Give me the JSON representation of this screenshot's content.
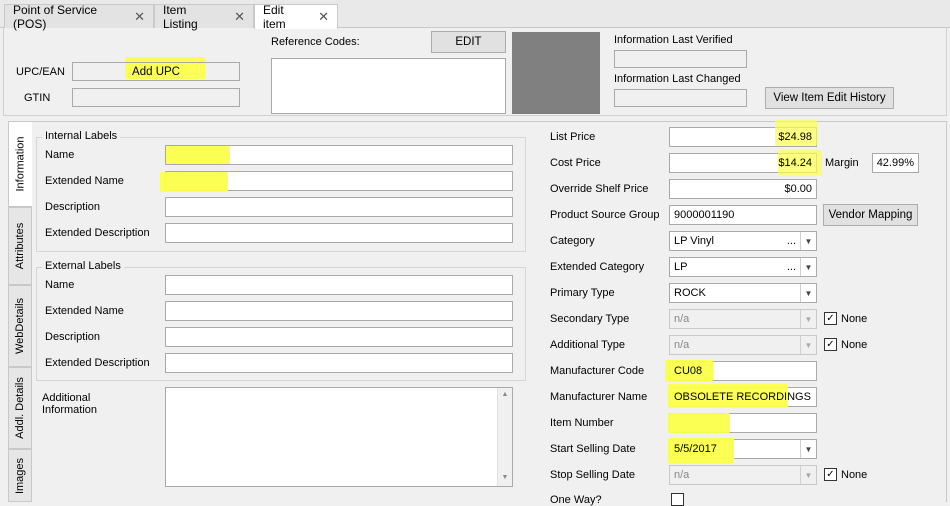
{
  "tabs": [
    {
      "label": "Point of Service (POS)"
    },
    {
      "label": "Item Listing"
    },
    {
      "label": "Edit item"
    }
  ],
  "top": {
    "upc_label": "UPC/EAN",
    "upc_button": "Add UPC",
    "gtin_label": "GTIN",
    "reference_codes_label": "Reference Codes:",
    "edit_button": "EDIT",
    "last_verified_label": "Information Last Verified",
    "last_changed_label": "Information Last Changed",
    "history_button": "View Item Edit History"
  },
  "side_tabs": [
    {
      "label": "Information"
    },
    {
      "label": "Attributes"
    },
    {
      "label": "WebDetails"
    },
    {
      "label": "Addl. Details"
    },
    {
      "label": "Images"
    }
  ],
  "internal": {
    "title": "Internal Labels",
    "name": "Name",
    "extended_name": "Extended Name",
    "description": "Description",
    "extended_description": "Extended Description"
  },
  "external": {
    "title": "External Labels",
    "name": "Name",
    "extended_name": "Extended Name",
    "description": "Description",
    "extended_description": "Extended Description"
  },
  "additional_info_label": "Additional Information",
  "right": {
    "list_price_label": "List Price",
    "list_price": "$24.98",
    "cost_price_label": "Cost Price",
    "cost_price": "$14.24",
    "margin_label": "Margin",
    "margin": "42.99%",
    "override_label": "Override Shelf Price",
    "override": "$0.00",
    "psg_label": "Product Source Group",
    "psg": "9000001190",
    "vendor_button": "Vendor Mapping",
    "category_label": "Category",
    "category": "LP Vinyl",
    "ext_category_label": "Extended Category",
    "ext_category": "LP",
    "primary_type_label": "Primary Type",
    "primary_type": "ROCK",
    "secondary_type_label": "Secondary Type",
    "secondary_type": "n/a",
    "none_label": "None",
    "additional_type_label": "Additional Type",
    "additional_type": "n/a",
    "mfr_code_label": "Manufacturer Code",
    "mfr_code": "CU08",
    "mfr_name_label": "Manufacturer Name",
    "mfr_name": "OBSOLETE RECORDINGS",
    "item_number_label": "Item Number",
    "item_number": "",
    "start_date_label": "Start Selling Date",
    "start_date": "5/5/2017",
    "stop_date_label": "Stop Selling Date",
    "stop_date": "n/a",
    "one_way_label": "One Way?"
  },
  "glyphs": {
    "close": "✕",
    "check": "✓",
    "arrow": "▼",
    "dots": "..."
  },
  "colors": {
    "highlight": "#fbff4a",
    "image_box": "#808080"
  }
}
